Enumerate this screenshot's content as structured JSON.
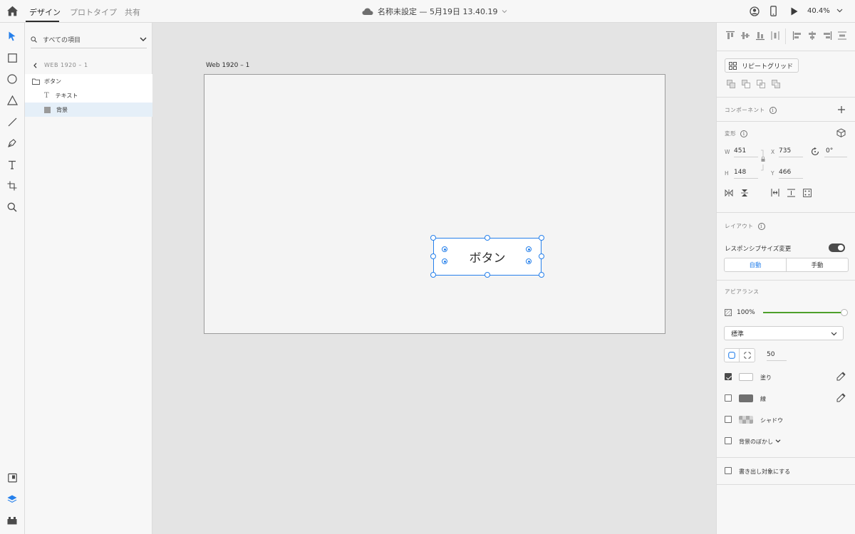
{
  "topbar": {
    "tabs": [
      "デザイン",
      "プロトタイプ",
      "共有"
    ],
    "active_tab": "デザイン",
    "doc_title": "名称未設定 — 5月19日 13.40.19",
    "zoom": "40.4%"
  },
  "layers": {
    "search_placeholder": "すべての項目",
    "breadcrumb": "WEB 1920 – 1",
    "items": [
      {
        "label": "ボタン",
        "type": "group"
      },
      {
        "label": "テキスト",
        "type": "text"
      },
      {
        "label": "背景",
        "type": "rectangle"
      }
    ]
  },
  "canvas": {
    "artboard_label": "Web 1920 – 1",
    "button_text": "ボタン"
  },
  "properties": {
    "repeat_grid_label": "リピートグリッド",
    "component_title": "コンポーネント",
    "transform_title": "変形",
    "w_label": "W",
    "w_value": "451",
    "x_label": "X",
    "x_value": "735",
    "h_label": "H",
    "h_value": "148",
    "y_label": "Y",
    "y_value": "466",
    "rotation": "0°",
    "layout_title": "レイアウト",
    "responsive_label": "レスポンシブサイズ変更",
    "responsive_on": true,
    "seg_auto": "自動",
    "seg_manual": "手動",
    "appearance_title": "アピアランス",
    "opacity": "100%",
    "blend_mode": "標準",
    "corner_radius": "50",
    "fill_label": "塗り",
    "fill_checked": true,
    "fill_color": "#ffffff",
    "stroke_label": "線",
    "stroke_checked": false,
    "stroke_color": "#707070",
    "shadow_label": "シャドウ",
    "shadow_checked": false,
    "bg_blur_label": "背景のぼかし",
    "bg_blur_checked": false,
    "export_label": "書き出し対象にする",
    "export_checked": false
  },
  "colors": {
    "accent": "#2680eb",
    "opacity_slider": "#4ea02b"
  }
}
